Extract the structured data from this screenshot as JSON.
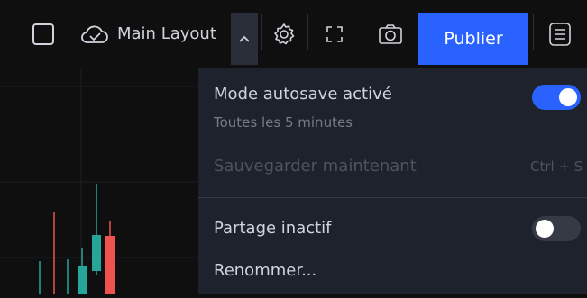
{
  "toolbar": {
    "layout_name": "Main Layout",
    "publish_label": "Publier",
    "icons": [
      "square-icon",
      "cloud-check-icon",
      "chevron-up-icon",
      "gear-icon",
      "fullscreen-icon",
      "camera-icon",
      "menu-icon"
    ]
  },
  "dropdown": {
    "autosave_label": "Mode autosave activé",
    "autosave_sub": "Toutes les 5 minutes",
    "autosave_on": true,
    "save_now_label": "Sauvegarder maintenant",
    "save_now_shortcut": "Ctrl + S",
    "sharing_label": "Partage inactif",
    "sharing_on": false,
    "rename_label": "Renommer..."
  },
  "colors": {
    "accent": "#2962ff",
    "up": "#26a69a",
    "down": "#ef5350"
  }
}
